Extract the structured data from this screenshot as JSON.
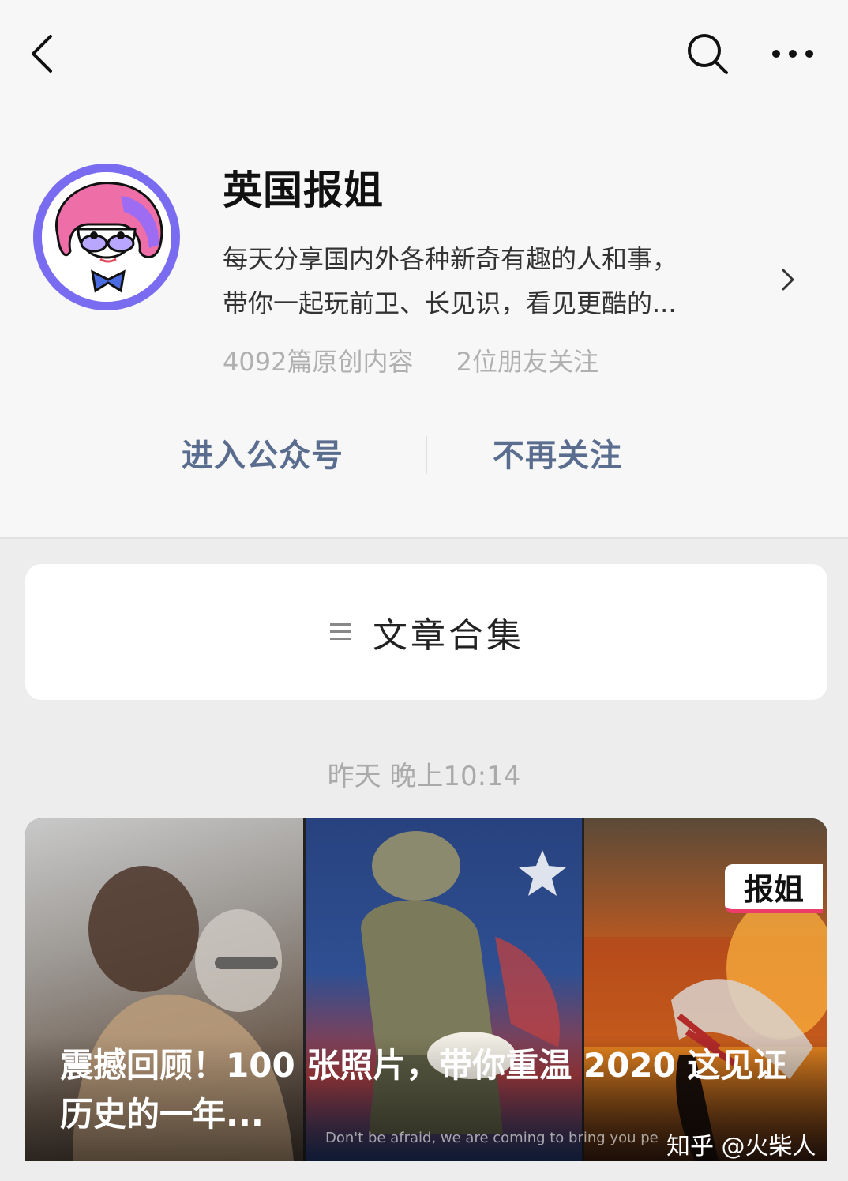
{
  "account": {
    "name": "英国报姐",
    "description_line1": "每天分享国内外各种新奇有趣的人和事，",
    "description_line2": "带你一起玩前卫、长见识，看见更酷的...",
    "original_count": "4092篇原创内容",
    "friends_following": "2位朋友关注"
  },
  "actions": {
    "enter": "进入公众号",
    "unfollow": "不再关注"
  },
  "collection": {
    "label": "文章合集"
  },
  "feed": {
    "timestamp": "昨天 晚上10:14",
    "article": {
      "title": "震撼回顾！100 张照片，带你重温 2020 这见证历史的一年...",
      "logo_text": "报姐",
      "photo_caption": "Don't be afraid, we are coming to bring you pe",
      "watermark": "知乎 @火柴人"
    }
  },
  "icons": [
    "back-icon",
    "search-icon",
    "more-icon",
    "chevron-right-icon",
    "menu-list-icon"
  ],
  "colors": {
    "header_bg": "#f7f7f7",
    "page_bg": "#ededed",
    "action_text": "#5a6d8f",
    "avatar_ring": "#7a6cf0",
    "logo_accent": "#ec3c6a"
  }
}
